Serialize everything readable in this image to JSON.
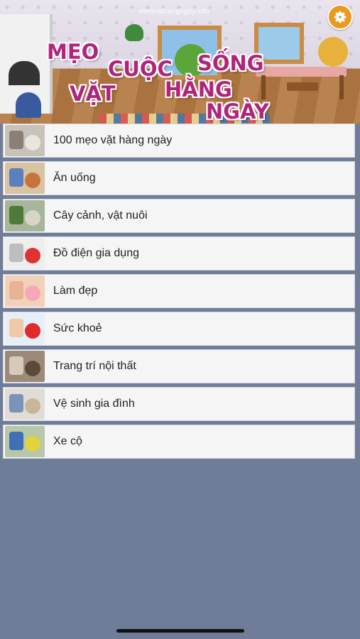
{
  "header": {
    "site_url": "meovathangngay.info",
    "title_words": [
      "MẸO",
      "CUỘC",
      "SỐNG",
      "VẶT",
      "HẰNG",
      "NGÀY"
    ],
    "settings_icon": "gear-icon"
  },
  "menu": {
    "items": [
      {
        "label": "100 mẹo vặt hàng ngày",
        "icon": "dishes-thumbnail"
      },
      {
        "label": "Ăn uống",
        "icon": "food-thumbnail"
      },
      {
        "label": "Cây cảnh, vật nuôi",
        "icon": "plants-pets-thumbnail"
      },
      {
        "label": "Đồ điện gia dụng",
        "icon": "appliances-thumbnail"
      },
      {
        "label": "Làm đẹp",
        "icon": "beauty-thumbnail"
      },
      {
        "label": "Sức khoẻ",
        "icon": "health-thumbnail"
      },
      {
        "label": "Trang trí nội thất",
        "icon": "interior-thumbnail"
      },
      {
        "label": "Vệ sinh gia đình",
        "icon": "cleaning-thumbnail"
      },
      {
        "label": "Xe cộ",
        "icon": "vehicles-thumbnail"
      }
    ]
  },
  "colors": {
    "background": "#6f7d99",
    "title": "#b0247c",
    "settings": "#e89a22",
    "row": "#f5f5f5"
  }
}
